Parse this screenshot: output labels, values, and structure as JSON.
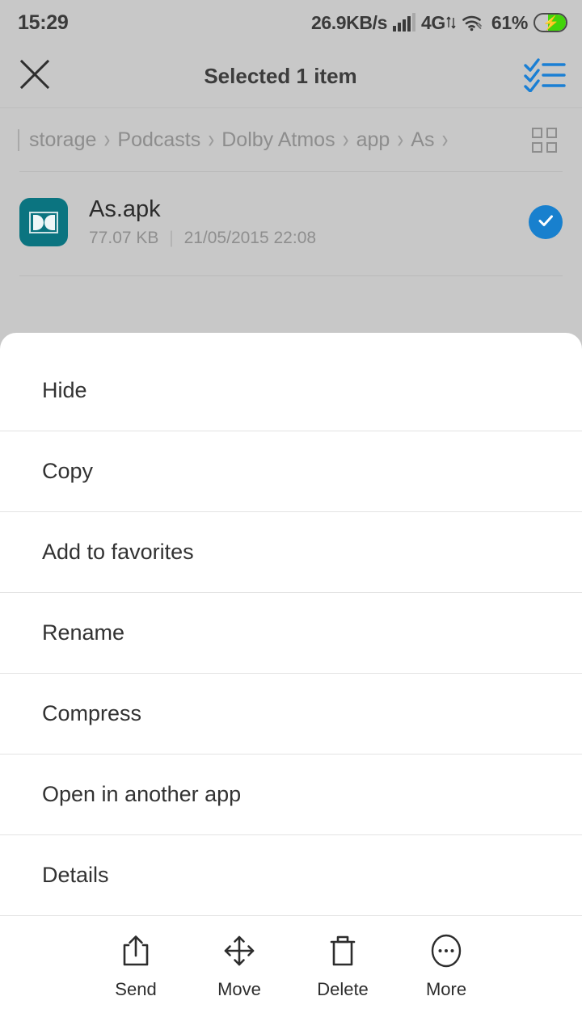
{
  "statusbar": {
    "time": "15:29",
    "net_speed": "26.9KB/s",
    "net_type": "4G",
    "battery_percent": "61%",
    "signal_icon": "signal-bars-icon",
    "wifi_icon": "wifi-icon",
    "battery_icon": "battery-charging-icon"
  },
  "appbar": {
    "close_icon": "close-icon",
    "title": "Selected 1 item",
    "select_all_icon": "select-all-checklist-icon"
  },
  "breadcrumb": {
    "separator": "›",
    "items": [
      {
        "label": "storage"
      },
      {
        "label": "Podcasts"
      },
      {
        "label": "Dolby Atmos"
      },
      {
        "label": "app"
      },
      {
        "label": "As"
      }
    ],
    "grid_view_icon": "grid-view-icon"
  },
  "file": {
    "name": "As.apk",
    "size": "77.07 KB",
    "meta_separator": "|",
    "date": "21/05/2015 22:08",
    "icon": "dolby-app-icon",
    "selected": true,
    "check_icon": "check-circle-icon"
  },
  "menu": {
    "items": [
      {
        "label": "Hide"
      },
      {
        "label": "Copy"
      },
      {
        "label": "Add to favorites"
      },
      {
        "label": "Rename"
      },
      {
        "label": "Compress"
      },
      {
        "label": "Open in another app"
      },
      {
        "label": "Details"
      }
    ]
  },
  "bottom_bar": {
    "actions": [
      {
        "label": "Send",
        "icon": "share-upload-icon"
      },
      {
        "label": "Move",
        "icon": "move-arrows-icon"
      },
      {
        "label": "Delete",
        "icon": "trash-icon"
      },
      {
        "label": "More",
        "icon": "more-ellipsis-icon"
      }
    ]
  },
  "colors": {
    "accent_blue": "#1880ce",
    "background_gray": "#c8c8c8",
    "sheet_white": "#ffffff",
    "dolby_teal": "#0b7480",
    "battery_green": "#42d40a"
  }
}
